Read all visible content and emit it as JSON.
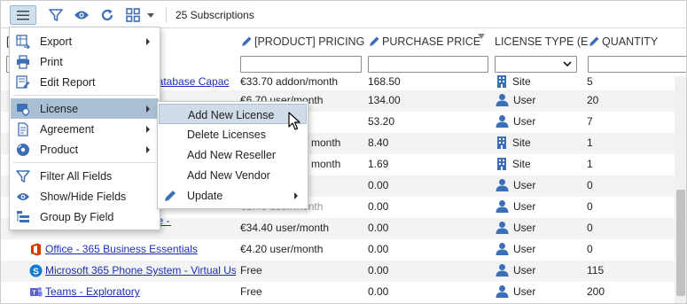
{
  "toolbar": {
    "count_label": "25 Subscriptions",
    "icons": [
      "hamburger-icon",
      "filter-icon",
      "eye-icon",
      "refresh-icon",
      "grid-icon",
      "caret-down-icon"
    ]
  },
  "columns": {
    "partial_first": "[",
    "pricing": "[PRODUCT] PRICING",
    "purchase_price": "PURCHASE PRICE",
    "license_type": "LICENSE TYPE (E",
    "quantity": "QUANTITY"
  },
  "rows": [
    {
      "name": "Database Capac",
      "pricing": "€33.70 addon/month",
      "purchase": "168.50",
      "ltype": "Site",
      "qty": "5"
    },
    {
      "name": "...",
      "pricing": "€6.70 user/month",
      "purchase": "134.00",
      "ltype": "User",
      "qty": "20"
    },
    {
      "name": "",
      "pricing": "",
      "purchase": "53.20",
      "ltype": "User",
      "qty": "7"
    },
    {
      "name": "",
      "pricing": "month",
      "purchase": "8.40",
      "ltype": "Site",
      "qty": "1"
    },
    {
      "name": "",
      "pricing": "month",
      "purchase": "1.69",
      "ltype": "Site",
      "qty": "1"
    },
    {
      "name": "",
      "pricing": "",
      "purchase": "0.00",
      "ltype": "User",
      "qty": "0"
    },
    {
      "name": "",
      "pricing": "€3.40 user/month",
      "purchase": "0.00",
      "ltype": "User",
      "qty": "0"
    },
    {
      "name": "Office - E5",
      "pricing": "€34.40 user/month",
      "purchase": "0.00",
      "ltype": "User",
      "qty": "0"
    },
    {
      "name": "Office - 365 Business Essentials",
      "pricing": "€4.20 user/month",
      "purchase": "0.00",
      "ltype": "User",
      "qty": "0"
    },
    {
      "name": "Microsoft 365 Phone System - Virtual Us",
      "pricing": "Free",
      "purchase": "0.00",
      "ltype": "User",
      "qty": "115"
    },
    {
      "name": "Teams - Exploratory",
      "pricing": "Free",
      "purchase": "0.00",
      "ltype": "User",
      "qty": "200"
    }
  ],
  "main_menu": {
    "export": "Export",
    "print": "Print",
    "edit_report": "Edit Report",
    "license": "License",
    "agreement": "Agreement",
    "product": "Product",
    "filter_all": "Filter All Fields",
    "show_hide": "Show/Hide Fields",
    "group_by": "Group By Field"
  },
  "license_submenu": {
    "add_license": "Add New License",
    "delete_licenses": "Delete Licenses",
    "add_reseller": "Add New Reseller",
    "add_vendor": "Add New Vendor",
    "update": "Update"
  },
  "colors": {
    "link": "#1a2fb5",
    "accent_blue": "#3d6fb5",
    "menu_active": "#a9c0d4",
    "office_red": "#d83b01",
    "skype_blue": "#0f7bd3",
    "teams_purple": "#5b5fc7"
  }
}
